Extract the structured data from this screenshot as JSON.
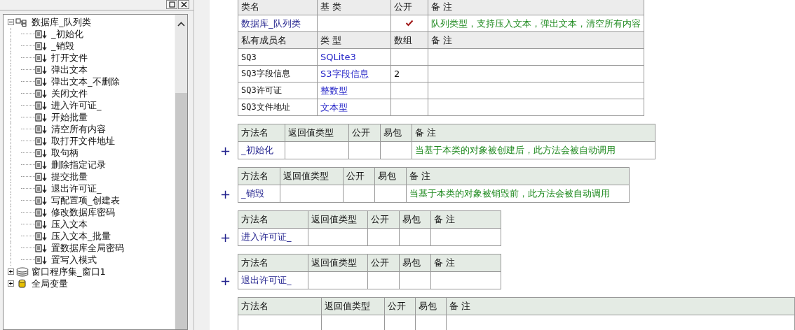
{
  "tree": [
    {
      "kind": "class",
      "label": "数据库_队列类",
      "expanded": true,
      "children": [
        {
          "kind": "method",
          "label": "_初始化"
        },
        {
          "kind": "method",
          "label": "_销毁"
        },
        {
          "kind": "method",
          "label": "打开文件"
        },
        {
          "kind": "method",
          "label": "弹出文本"
        },
        {
          "kind": "method",
          "label": "弹出文本_不删除"
        },
        {
          "kind": "method",
          "label": "关闭文件"
        },
        {
          "kind": "method",
          "label": "进入许可证_"
        },
        {
          "kind": "method",
          "label": "开始批量"
        },
        {
          "kind": "method",
          "label": "清空所有内容"
        },
        {
          "kind": "method",
          "label": "取打开文件地址"
        },
        {
          "kind": "method",
          "label": "取句柄"
        },
        {
          "kind": "method",
          "label": "删除指定记录"
        },
        {
          "kind": "method",
          "label": "提交批量"
        },
        {
          "kind": "method",
          "label": "退出许可证_"
        },
        {
          "kind": "method",
          "label": "写配置项_创建表"
        },
        {
          "kind": "method",
          "label": "修改数据库密码"
        },
        {
          "kind": "method",
          "label": "压入文本"
        },
        {
          "kind": "method",
          "label": "压入文本_批量"
        },
        {
          "kind": "method",
          "label": "置数据库全局密码"
        },
        {
          "kind": "method",
          "label": "置写入模式"
        }
      ]
    },
    {
      "kind": "window_set",
      "label": "窗口程序集_窗口1",
      "expanded": false
    },
    {
      "kind": "global",
      "label": "全局变量",
      "expanded": false
    }
  ],
  "class_table": {
    "columns": [
      "类名",
      "基 类",
      "公开",
      "备 注"
    ],
    "class_row": {
      "name": "数据库_队列类",
      "public": true,
      "note": "队列类型，支持压入文本，弹出文本，清空所有内容"
    },
    "member_columns": [
      "私有成员名",
      "类 型",
      "数组",
      "备 注"
    ],
    "members": [
      {
        "name": "SQ3",
        "type": "SQLite3"
      },
      {
        "name": "SQ3字段信息",
        "type": "S3字段信息",
        "array": "2"
      },
      {
        "name": "SQ3许可证",
        "type": "整数型"
      },
      {
        "name": "SQ3文件地址",
        "type": "文本型"
      }
    ]
  },
  "methods": [
    {
      "expand": "+",
      "columns": [
        "方法名",
        "返回值类型",
        "公开",
        "易包",
        "备 注"
      ],
      "name": "_初始化",
      "public": false,
      "note": "当基于本类的对象被创建后，此方法会被自动调用"
    },
    {
      "expand": "+",
      "columns": [
        "方法名",
        "返回值类型",
        "公开",
        "易包",
        "备 注"
      ],
      "name": "_销毁",
      "public": false,
      "note": "当基于本类的对象被销毁前，此方法会被自动调用"
    },
    {
      "expand": "+",
      "columns": [
        "方法名",
        "返回值类型",
        "公开",
        "易包",
        "备 注"
      ],
      "name": "进入许可证_",
      "public": false
    },
    {
      "expand": "+",
      "columns": [
        "方法名",
        "返回值类型",
        "公开",
        "易包",
        "备 注"
      ],
      "name": "退出许可证_",
      "public": false
    },
    {
      "columns": [
        "方法名",
        "返回值类型",
        "公开",
        "易包",
        "备 注"
      ],
      "public": false
    }
  ]
}
